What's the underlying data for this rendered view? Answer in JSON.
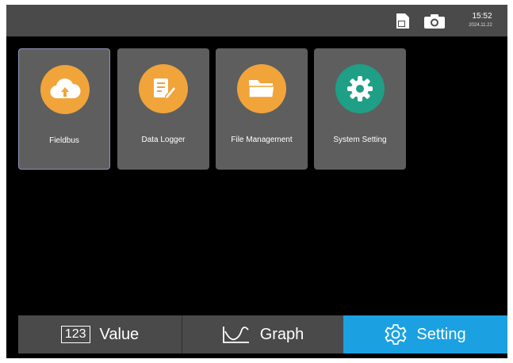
{
  "status": {
    "time": "15:52",
    "date": "2024.11.22",
    "icons": [
      "sd-card-icon",
      "camera-icon"
    ]
  },
  "tiles": [
    {
      "label": "Fieldbus",
      "icon": "cloud-upload-icon",
      "color": "#f0a43a",
      "selected": true
    },
    {
      "label": "Data Logger",
      "icon": "notepad-edit-icon",
      "color": "#f0a43a"
    },
    {
      "label": "File Management",
      "icon": "folder-icon",
      "color": "#f0a43a"
    },
    {
      "label": "System Setting",
      "icon": "gear-icon",
      "color": "#1f9f86"
    }
  ],
  "nav": {
    "value": {
      "icon_text": "123",
      "label": "Value"
    },
    "graph": {
      "label": "Graph",
      "icon": "graph-icon"
    },
    "setting": {
      "label": "Setting",
      "icon": "gear-icon",
      "active": true
    }
  },
  "colors": {
    "accent": "#1ba1e2",
    "tile": "#5e5e5e",
    "bar": "#4a4a4a"
  }
}
